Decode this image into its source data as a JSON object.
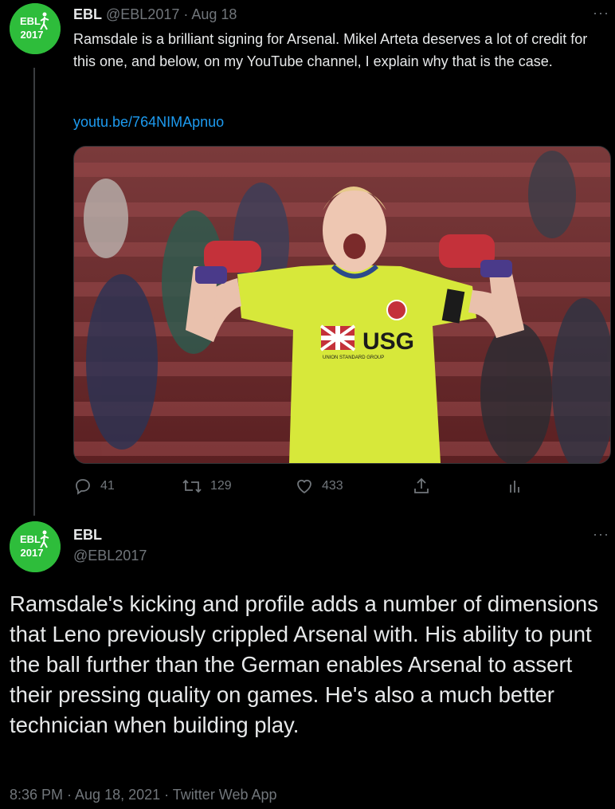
{
  "tweet1": {
    "display_name": "EBL",
    "handle": "@EBL2017",
    "separator": "·",
    "date": "Aug 18",
    "text": "Ramsdale is a brilliant signing for Arsenal. Mikel Arteta deserves a lot of credit for this one, and below, on my YouTube channel, I explain why that is the case.",
    "link": "youtu.be/764NIMApnuo",
    "more": "···",
    "actions": {
      "replies": "41",
      "retweets": "129",
      "likes": "433"
    },
    "image": {
      "sponsor_text": "USG",
      "sponsor_subtext": "UNION STANDARD GROUP"
    }
  },
  "tweet2": {
    "display_name": "EBL",
    "handle": "@EBL2017",
    "more": "···",
    "text": "Ramsdale's kicking and profile adds a number of dimensions that Leno previously crippled Arsenal with. His ability to punt the ball further than the German enables Arsenal to assert their pressing quality on games. He's also a much better technician when building play.",
    "footer": "8:36 PM · Aug 18, 2021 · Twitter Web App"
  },
  "avatar": {
    "line1": "EBL",
    "line2": "2017"
  },
  "colors": {
    "background": "#000000",
    "text": "#e7e9ea",
    "muted": "#71767b",
    "link": "#1d9bf0",
    "avatar_green": "#2ebd3b"
  }
}
